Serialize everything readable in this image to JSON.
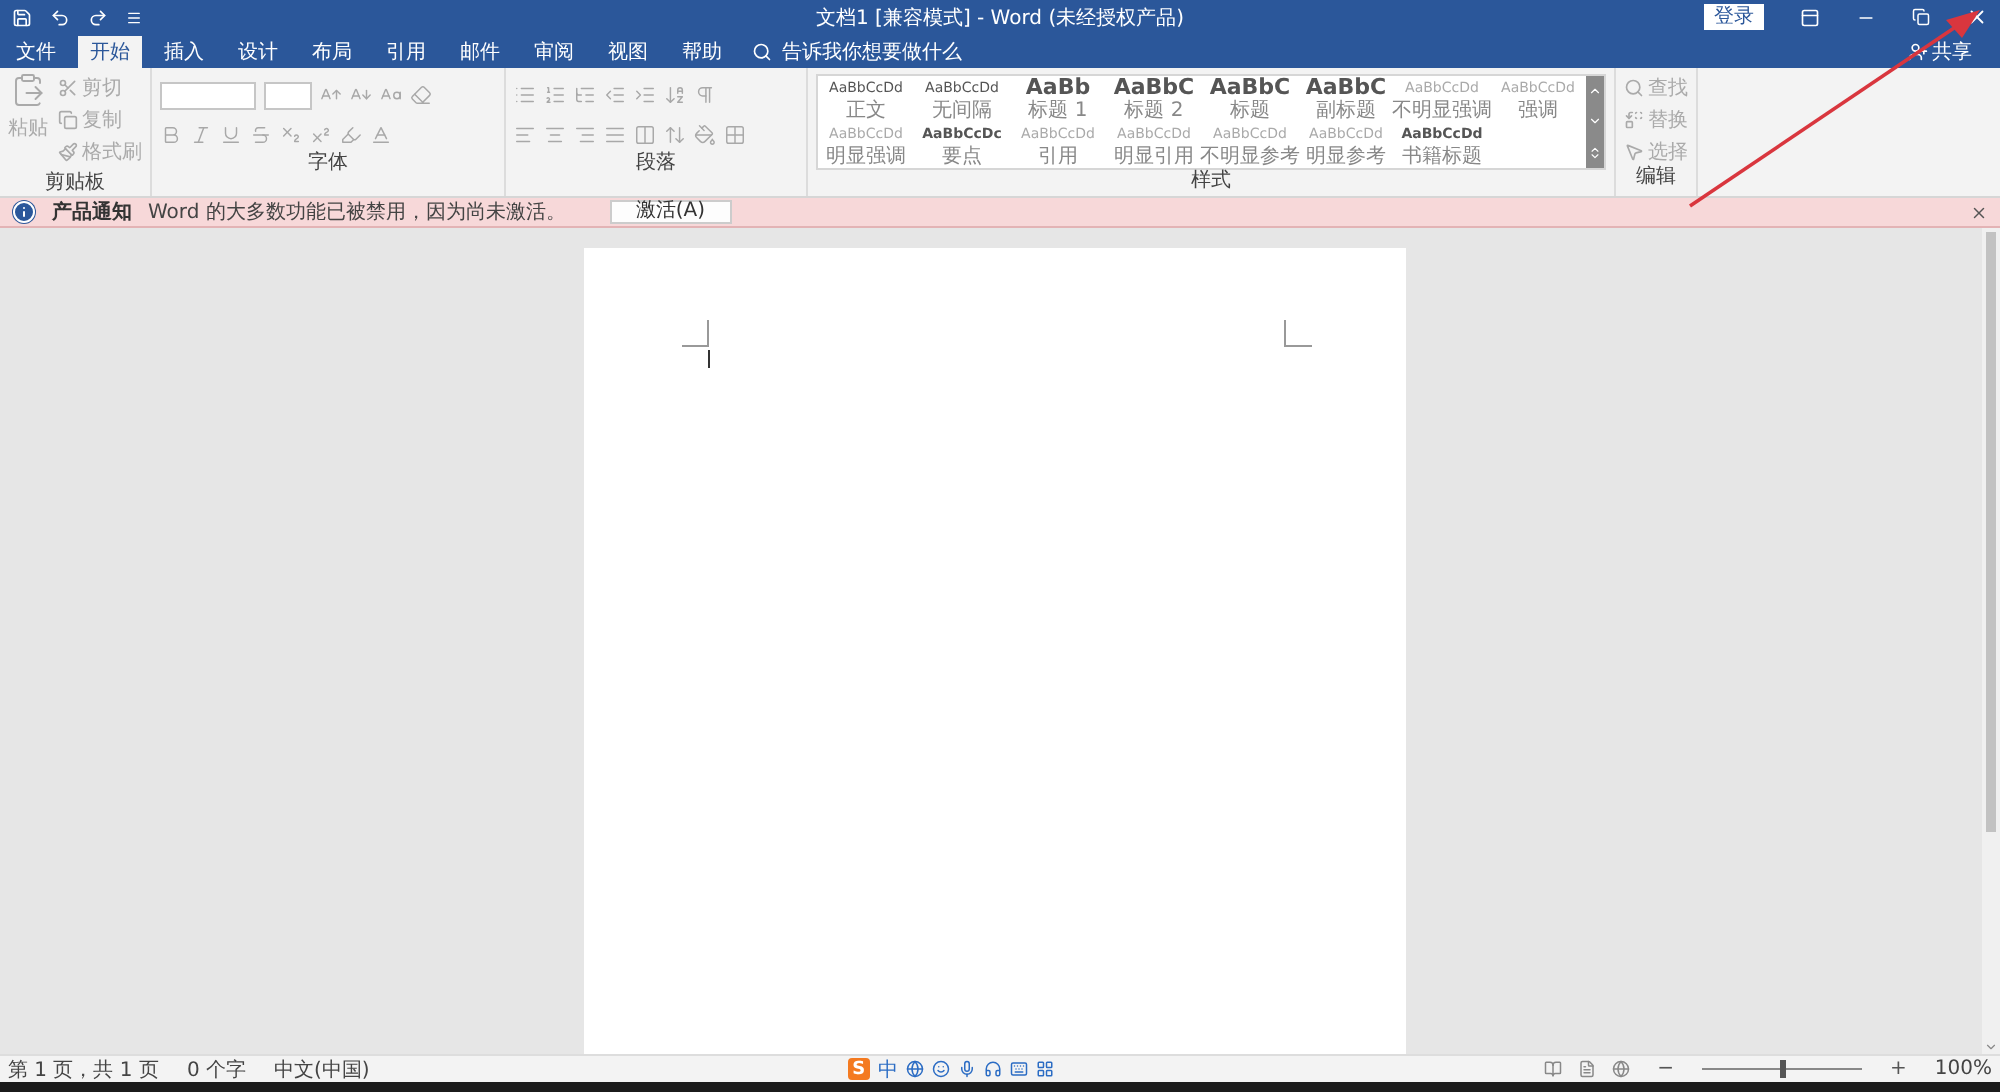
{
  "title_bar": {
    "title": "文档1 [兼容模式] - Word (未经授权产品)",
    "sign_in": "登录"
  },
  "tabs": [
    {
      "label": "文件",
      "selected": false
    },
    {
      "label": "开始",
      "selected": true
    },
    {
      "label": "插入",
      "selected": false
    },
    {
      "label": "设计",
      "selected": false
    },
    {
      "label": "布局",
      "selected": false
    },
    {
      "label": "引用",
      "selected": false
    },
    {
      "label": "邮件",
      "selected": false
    },
    {
      "label": "审阅",
      "selected": false
    },
    {
      "label": "视图",
      "selected": false
    },
    {
      "label": "帮助",
      "selected": false
    }
  ],
  "tell_me": {
    "placeholder": "告诉我你想要做什么"
  },
  "share": "共享",
  "ribbon": {
    "clipboard": {
      "paste": "粘贴",
      "cut": "剪切",
      "copy": "复制",
      "format_painter": "格式刷",
      "label": "剪贴板"
    },
    "font": {
      "label": "字体"
    },
    "paragraph": {
      "label": "段落"
    },
    "styles": {
      "label": "样式",
      "items": [
        {
          "preview": "AaBbCcDd",
          "name": "正文",
          "kind": "plain"
        },
        {
          "preview": "AaBbCcDd",
          "name": "无间隔",
          "kind": "plain"
        },
        {
          "preview": "AaBb",
          "name": "标题 1",
          "kind": "heading"
        },
        {
          "preview": "AaBbC",
          "name": "标题 2",
          "kind": "heading"
        },
        {
          "preview": "AaBbC",
          "name": "标题",
          "kind": "heading"
        },
        {
          "preview": "AaBbC",
          "name": "副标题",
          "kind": "heading"
        },
        {
          "preview": "AaBbCcDd",
          "name": "不明显强调",
          "kind": "subtle"
        },
        {
          "preview": "AaBbCcDd",
          "name": "强调",
          "kind": "subtle"
        },
        {
          "preview": "AaBbCcDd",
          "name": "明显强调",
          "kind": "subtle"
        },
        {
          "preview": "AaBbCcDc",
          "name": "要点",
          "kind": "strong"
        },
        {
          "preview": "AaBbCcDd",
          "name": "引用",
          "kind": "subtle"
        },
        {
          "preview": "AaBbCcDd",
          "name": "明显引用",
          "kind": "subtle"
        },
        {
          "preview": "AaBbCcDd",
          "name": "不明显参考",
          "kind": "subtle"
        },
        {
          "preview": "AaBbCcDd",
          "name": "明显参考",
          "kind": "subtle"
        },
        {
          "preview": "AaBbCcDd",
          "name": "书籍标题",
          "kind": "strong"
        }
      ]
    },
    "editing": {
      "find": "查找",
      "replace": "替换",
      "select": "选择",
      "label": "编辑"
    }
  },
  "notification": {
    "title": "产品通知",
    "message": "Word 的大多数功能已被禁用，因为尚未激活。",
    "button": "激活(A)"
  },
  "status_bar": {
    "page": "第 1 页，共 1 页",
    "words": "0 个字",
    "language": "中文(中国)",
    "ime_logo": "S",
    "ime_mode": "中",
    "zoom": {
      "level": 0.5,
      "minus": "−",
      "plus": "+",
      "reading": "100%"
    }
  }
}
